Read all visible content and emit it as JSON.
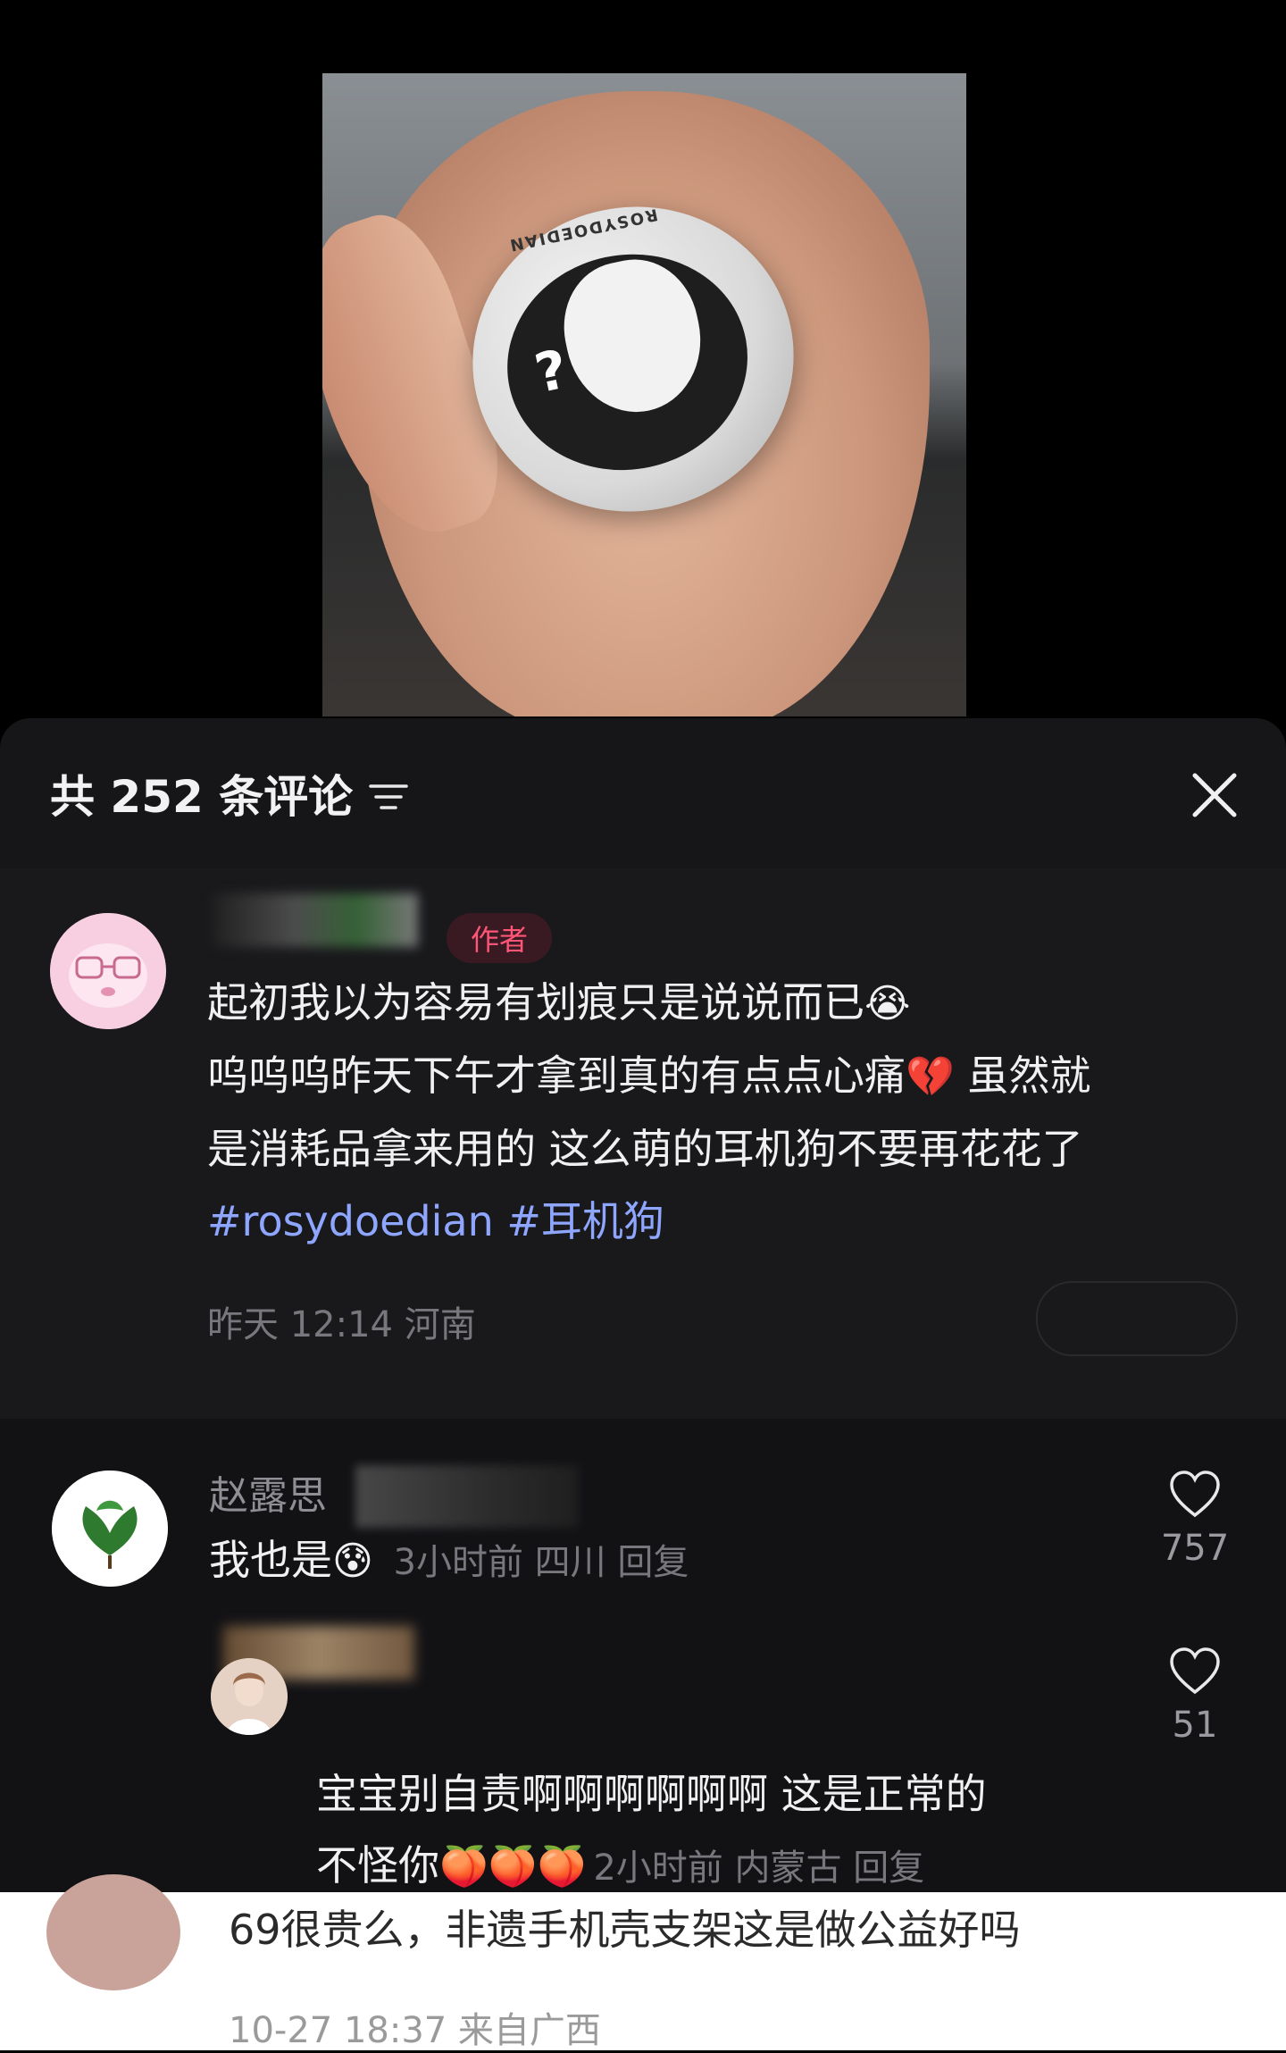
{
  "header": {
    "comment_count_label": "共 252 条评论"
  },
  "author_comment": {
    "badge": "作者",
    "text_line1": "起初我以为容易有划痕只是说说而已",
    "emoji1": "😭",
    "text_line2a": "呜呜呜昨天下午才拿到真的有点点心痛",
    "emoji2": "💔",
    "text_line2b": " 虽然就",
    "text_line3": "是消耗品拿来用的 这么萌的耳机狗不要再花花了",
    "tag1": "#rosydoedian",
    "tag2": " #耳机狗",
    "meta": "昨天 12:14 河南"
  },
  "reply_1": {
    "name": "赵露思",
    "text": "我也是",
    "emoji": "😰",
    "meta": "3小时前 四川 回复",
    "like_count": "757"
  },
  "reply_2": {
    "text_line1": "宝宝别自责啊啊啊啊啊啊 这是正常的",
    "text_line2": "不怪你",
    "emoji": "🍑🍑🍑",
    "meta": "2小时前 内蒙古 回复",
    "like_count": "51"
  },
  "bottom_comment": {
    "text": "69很贵么，非遗手机壳支架这是做公益好吗",
    "meta": "10-27 18:37 来自广西"
  },
  "photo": {
    "brand_text": "ROSYDOEDIAN"
  },
  "colors": {
    "sheet_bg": "#121215",
    "badge_text": "#ff5576",
    "hashtag": "#8fa6ff"
  }
}
